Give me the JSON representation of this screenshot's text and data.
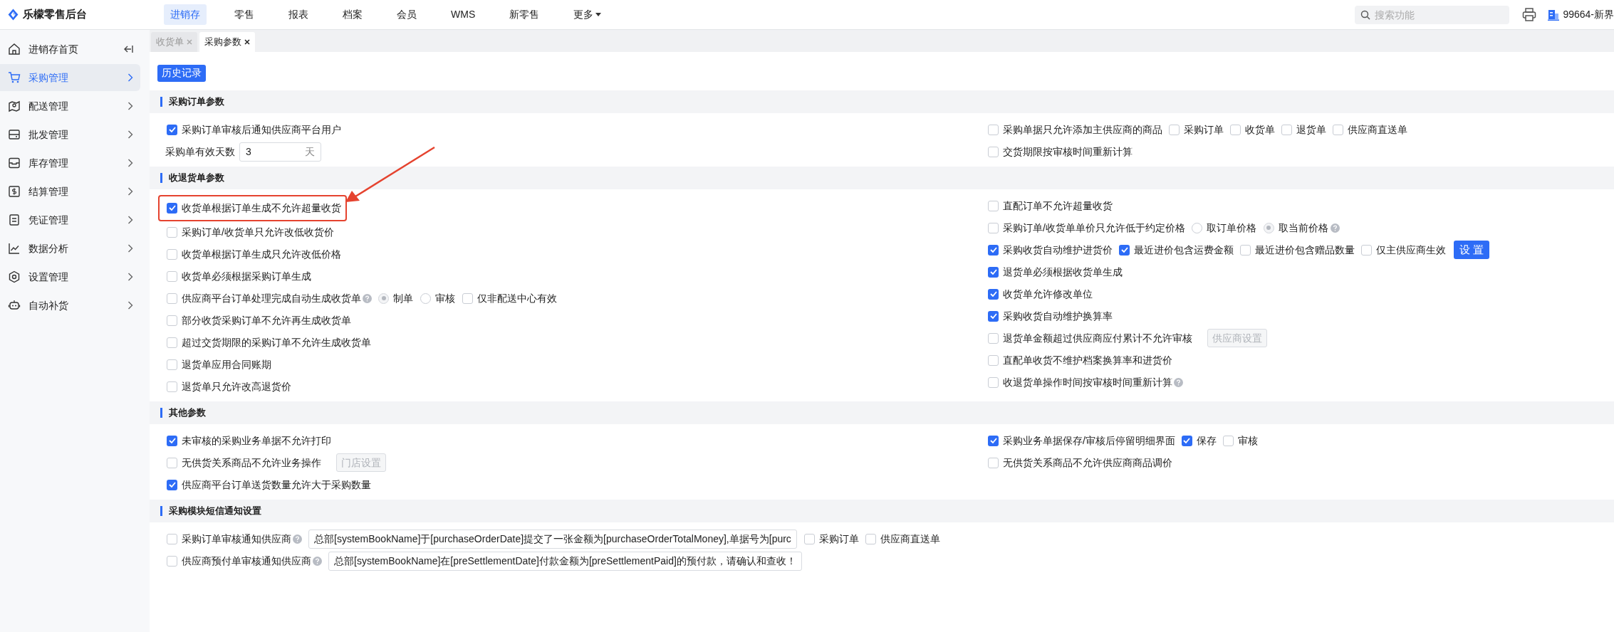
{
  "app": {
    "title": "乐檬零售后台"
  },
  "top_nav": [
    {
      "label": "进销存",
      "selected": true,
      "dropdown": false
    },
    {
      "label": "零售",
      "selected": false,
      "dropdown": false
    },
    {
      "label": "报表",
      "selected": false,
      "dropdown": false
    },
    {
      "label": "档案",
      "selected": false,
      "dropdown": false
    },
    {
      "label": "会员",
      "selected": false,
      "dropdown": false
    },
    {
      "label": "WMS",
      "selected": false,
      "dropdown": false
    },
    {
      "label": "新零售",
      "selected": false,
      "dropdown": false
    },
    {
      "label": "更多",
      "selected": false,
      "dropdown": true
    }
  ],
  "search": {
    "placeholder": "搜索功能"
  },
  "account": {
    "label": "99664-新界"
  },
  "sidebar": {
    "items": [
      {
        "label": "进销存首页",
        "selected": false
      },
      {
        "label": "采购管理",
        "selected": true
      },
      {
        "label": "配送管理",
        "selected": false
      },
      {
        "label": "批发管理",
        "selected": false
      },
      {
        "label": "库存管理",
        "selected": false
      },
      {
        "label": "结算管理",
        "selected": false
      },
      {
        "label": "凭证管理",
        "selected": false
      },
      {
        "label": "数据分析",
        "selected": false
      },
      {
        "label": "设置管理",
        "selected": false
      },
      {
        "label": "自动补货",
        "selected": false
      }
    ]
  },
  "tabs": [
    {
      "label": "收货单",
      "selected": false
    },
    {
      "label": "采购参数",
      "selected": true
    }
  ],
  "history_button": "历史记录",
  "sections": [
    {
      "title": "采购订单参数",
      "left": [
        [
          {
            "kind": "checkbox",
            "label": "采购订单审核后通知供应商平台用户",
            "checked": true
          }
        ],
        [
          {
            "kind": "number_field",
            "label": "采购单有效天数",
            "value": "3",
            "unit": "天"
          }
        ]
      ],
      "right": [
        [
          {
            "kind": "checkbox",
            "label": "采购单据只允许添加主供应商的商品",
            "checked": false
          },
          {
            "kind": "checkbox",
            "label": "采购订单",
            "checked": false
          },
          {
            "kind": "checkbox",
            "label": "收货单",
            "checked": false
          },
          {
            "kind": "checkbox",
            "label": "退货单",
            "checked": false
          },
          {
            "kind": "checkbox",
            "label": "供应商直送单",
            "checked": false
          }
        ],
        [
          {
            "kind": "checkbox",
            "label": "交货期限按审核时间重新计算",
            "checked": false
          }
        ]
      ]
    },
    {
      "title": "收退货单参数",
      "left": [
        [
          {
            "kind": "checkbox",
            "label": "收货单根据订单生成不允许超量收货",
            "checked": true,
            "highlighted": true
          }
        ],
        [
          {
            "kind": "checkbox",
            "label": "采购订单/收货单只允许改低收货价",
            "checked": false
          }
        ],
        [
          {
            "kind": "checkbox",
            "label": "收货单根据订单生成只允许改低价格",
            "checked": false
          }
        ],
        [
          {
            "kind": "checkbox",
            "label": "收货单必须根据采购订单生成",
            "checked": false
          }
        ],
        [
          {
            "kind": "checkbox",
            "label": "供应商平台订单处理完成自动生成收货单",
            "checked": false
          },
          {
            "kind": "help"
          },
          {
            "kind": "radio",
            "label": "制单",
            "selected": true
          },
          {
            "kind": "radio",
            "label": "审核",
            "selected": false
          },
          {
            "kind": "checkbox",
            "label": "仅非配送中心有效",
            "checked": false
          }
        ],
        [
          {
            "kind": "checkbox",
            "label": "部分收货采购订单不允许再生成收货单",
            "checked": false
          }
        ],
        [
          {
            "kind": "checkbox",
            "label": "超过交货期限的采购订单不允许生成收货单",
            "checked": false
          }
        ],
        [
          {
            "kind": "checkbox",
            "label": "退货单应用合同账期",
            "checked": false
          }
        ],
        [
          {
            "kind": "checkbox",
            "label": "退货单只允许改高退货价",
            "checked": false
          }
        ]
      ],
      "right": [
        [
          {
            "kind": "checkbox",
            "label": "直配订单不允许超量收货",
            "checked": false
          }
        ],
        [
          {
            "kind": "checkbox",
            "label": "采购订单/收货单单价只允许低于约定价格",
            "checked": false
          },
          {
            "kind": "radio",
            "label": "取订单价格",
            "selected": false
          },
          {
            "kind": "radio",
            "label": "取当前价格",
            "selected": true
          },
          {
            "kind": "help"
          }
        ],
        [
          {
            "kind": "checkbox",
            "label": "采购收货自动维护进货价",
            "checked": true
          },
          {
            "kind": "checkbox",
            "label": "最近进价包含运费金额",
            "checked": true
          },
          {
            "kind": "checkbox",
            "label": "最近进价包含赠品数量",
            "checked": false
          },
          {
            "kind": "checkbox",
            "label": "仅主供应商生效",
            "checked": false
          },
          {
            "kind": "button",
            "label": "设 置",
            "disabled": false
          }
        ],
        [
          {
            "kind": "checkbox",
            "label": "退货单必须根据收货单生成",
            "checked": true
          }
        ],
        [
          {
            "kind": "checkbox",
            "label": "收货单允许修改单位",
            "checked": true
          }
        ],
        [
          {
            "kind": "checkbox",
            "label": "采购收货自动维护换算率",
            "checked": true
          }
        ],
        [
          {
            "kind": "checkbox",
            "label": "退货单金额超过供应商应付累计不允许审核",
            "checked": false
          },
          {
            "kind": "button",
            "label": "供应商设置",
            "disabled": true
          }
        ],
        [
          {
            "kind": "checkbox",
            "label": "直配单收货不维护档案换算率和进货价",
            "checked": false
          }
        ],
        [
          {
            "kind": "checkbox",
            "label": "收退货单操作时间按审核时间重新计算",
            "checked": false
          },
          {
            "kind": "help"
          }
        ]
      ]
    },
    {
      "title": "其他参数",
      "left": [
        [
          {
            "kind": "checkbox",
            "label": "未审核的采购业务单据不允许打印",
            "checked": true
          }
        ],
        [
          {
            "kind": "checkbox",
            "label": "无供货关系商品不允许业务操作",
            "checked": false
          },
          {
            "kind": "button",
            "label": "门店设置",
            "disabled": true
          }
        ],
        [
          {
            "kind": "checkbox",
            "label": "供应商平台订单送货数量允许大于采购数量",
            "checked": true
          }
        ]
      ],
      "right": [
        [
          {
            "kind": "checkbox",
            "label": "采购业务单据保存/审核后停留明细界面",
            "checked": true
          },
          {
            "kind": "checkbox",
            "label": "保存",
            "checked": true
          },
          {
            "kind": "checkbox",
            "label": "审核",
            "checked": false
          }
        ],
        [
          {
            "kind": "checkbox",
            "label": "无供货关系商品不允许供应商商品调价",
            "checked": false
          }
        ]
      ]
    },
    {
      "title": "采购模块短信通知设置",
      "left": [
        [
          {
            "kind": "checkbox",
            "label": "采购订单审核通知供应商",
            "checked": false
          },
          {
            "kind": "help"
          },
          {
            "kind": "text_field",
            "value": "总部[systemBookName]于[purchaseOrderDate]提交了一张金额为[purchaseOrderTotalMoney],单据号为[purc"
          },
          {
            "kind": "checkbox",
            "label": "采购订单",
            "checked": false
          },
          {
            "kind": "checkbox",
            "label": "供应商直送单",
            "checked": false
          }
        ],
        [
          {
            "kind": "checkbox",
            "label": "供应商预付单审核通知供应商",
            "checked": false
          },
          {
            "kind": "help"
          },
          {
            "kind": "text_field",
            "value": "总部[systemBookName]在[preSettlementDate]付款金额为[preSettlementPaid]的预付款，请确认和查收！"
          }
        ]
      ]
    }
  ]
}
